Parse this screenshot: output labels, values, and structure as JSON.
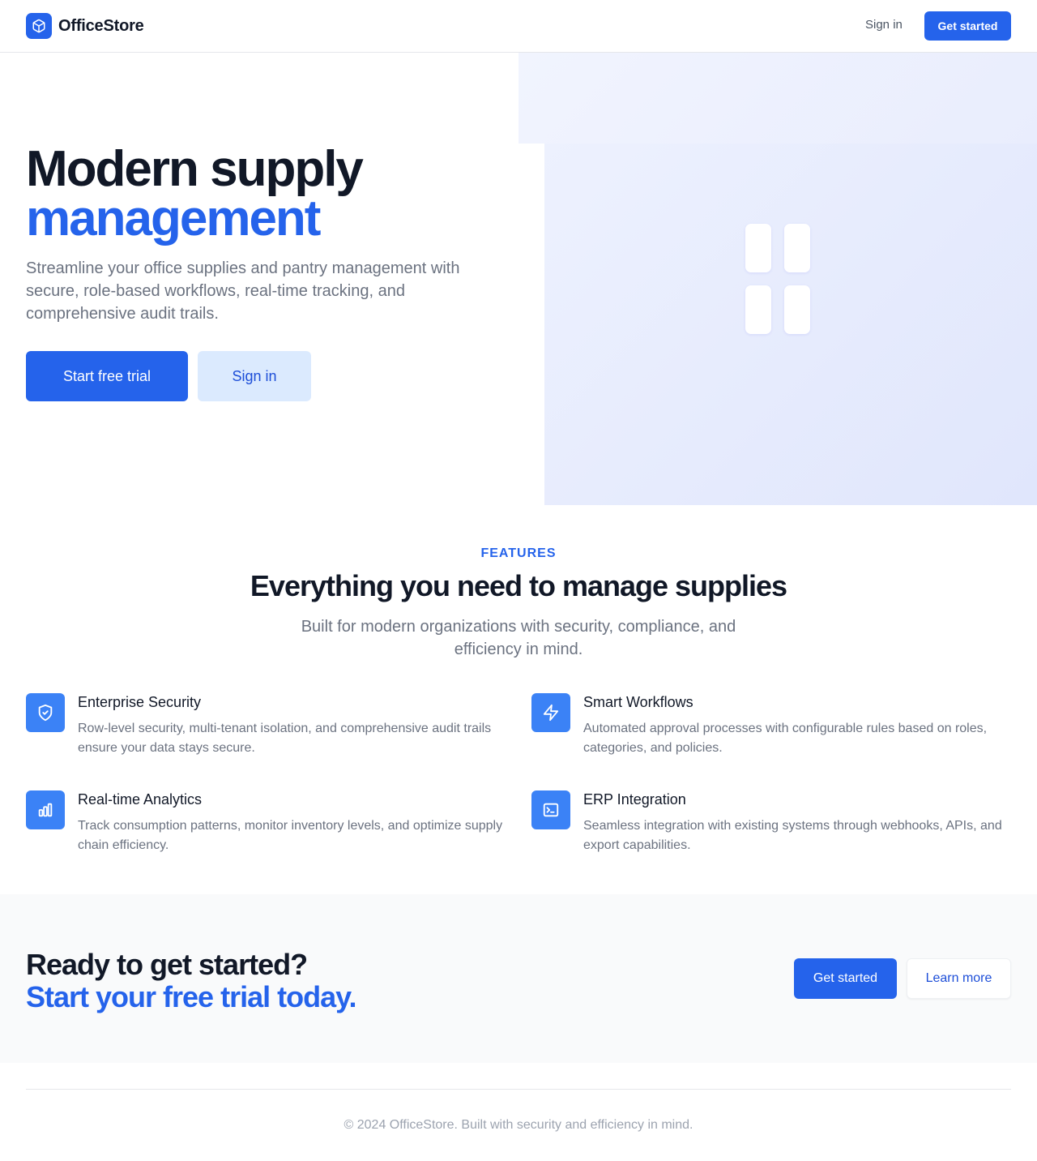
{
  "header": {
    "brand": "OfficeStore",
    "signin_label": "Sign in",
    "getstarted_label": "Get started"
  },
  "hero": {
    "title_line1": "Modern supply",
    "title_line2": "management",
    "description": "Streamline your office supplies and pantry management with secure, role-based workflows, real-time tracking, and comprehensive audit trails.",
    "primary_cta": "Start free trial",
    "secondary_cta": "Sign in"
  },
  "features": {
    "eyebrow": "FEATURES",
    "title": "Everything you need to manage supplies",
    "subtitle": "Built for modern organizations with security, compliance, and efficiency in mind.",
    "items": [
      {
        "icon": "shield-check-icon",
        "name": "Enterprise Security",
        "description": "Row-level security, multi-tenant isolation, and comprehensive audit trails ensure your data stays secure."
      },
      {
        "icon": "lightning-bolt-icon",
        "name": "Smart Workflows",
        "description": "Automated approval processes with configurable rules based on roles, categories, and policies."
      },
      {
        "icon": "bar-chart-icon",
        "name": "Real-time Analytics",
        "description": "Track consumption patterns, monitor inventory levels, and optimize supply chain efficiency."
      },
      {
        "icon": "terminal-icon",
        "name": "ERP Integration",
        "description": "Seamless integration with existing systems through webhooks, APIs, and export capabilities."
      }
    ]
  },
  "cta": {
    "line1": "Ready to get started?",
    "line2": "Start your free trial today.",
    "primary": "Get started",
    "secondary": "Learn more"
  },
  "footer": {
    "text": "© 2024 OfficeStore. Built with security and efficiency in mind."
  },
  "colors": {
    "brand": "#2563eb",
    "feature_icon_bg": "#3b82f6",
    "heading": "#111827",
    "muted": "#6b7280"
  }
}
